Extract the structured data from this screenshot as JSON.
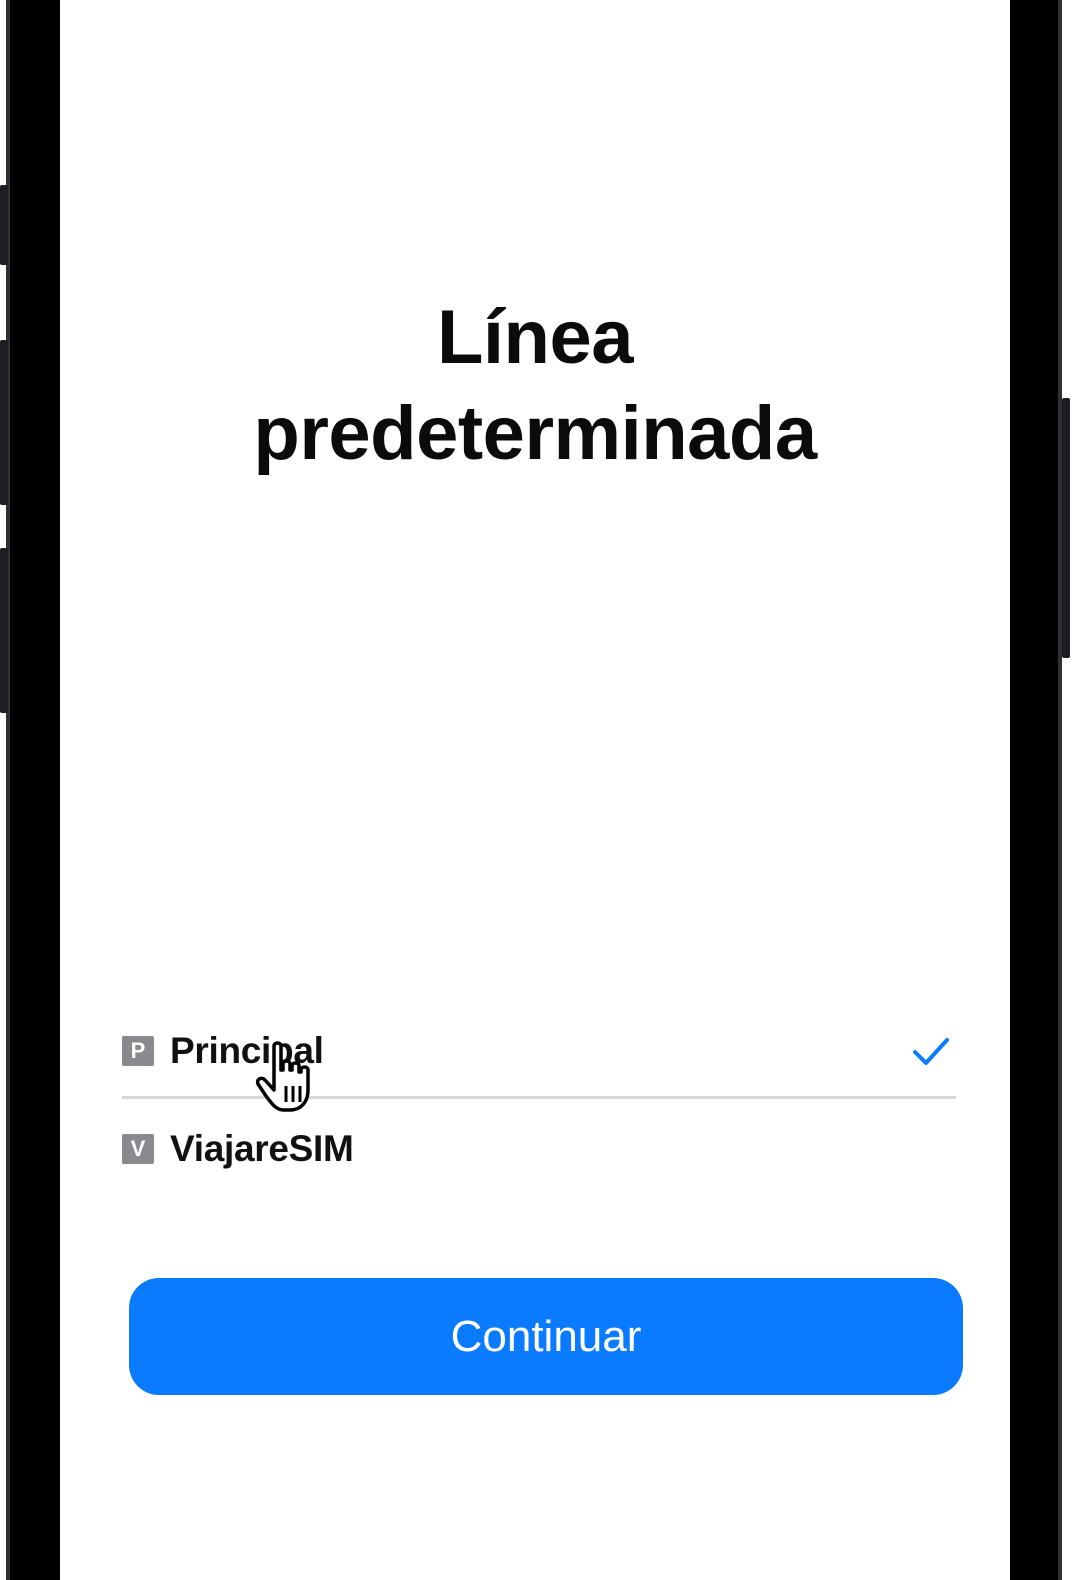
{
  "screen": {
    "title_line1": "Línea",
    "title_line2": "predeterminada"
  },
  "lines": [
    {
      "badge": "P",
      "label": "Principal",
      "selected": true
    },
    {
      "badge": "V",
      "label": "ViajareSIM",
      "selected": false
    }
  ],
  "continue_label": "Continuar",
  "colors": {
    "accent": "#0a7bff",
    "badge": "#8a8a8e",
    "divider": "#d7d7d9"
  },
  "icons": {
    "selected": "checkmark-icon",
    "pointer": "hand-cursor-icon"
  }
}
